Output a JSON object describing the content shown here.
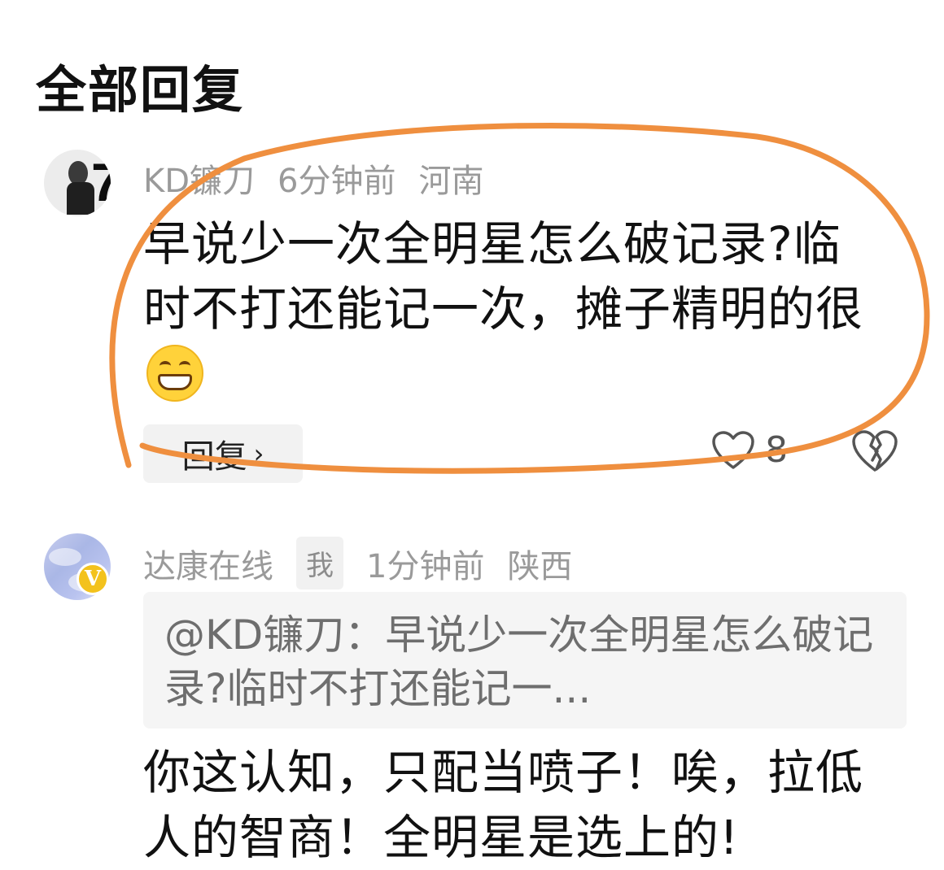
{
  "section": {
    "title": "全部回复"
  },
  "comments": [
    {
      "username": "KD镰刀",
      "time": "6分钟前",
      "location": "河南",
      "text": "早说少一次全明星怎么破记录?临时不打还能记一次，摊子精明的很",
      "emoji": "grinning-face-emoji",
      "reply_label": "回复",
      "like_count": "8",
      "avatar": "player-avatar-with-7"
    },
    {
      "username": "达康在线",
      "me_tag": "我",
      "time": "1分钟前",
      "location": "陕西",
      "quote": "@KD镰刀：早说少一次全明星怎么破记录?临时不打还能记一...",
      "text": "你这认知，只配当喷子！唉，拉低人的智商！全明星是选上的!",
      "badge": "V",
      "avatar": "sky-avatar"
    }
  ],
  "colors": {
    "annotation_circle": "#ef8f3f",
    "meta_text": "#9a9a9a",
    "vip_badge": "#f3c21d"
  },
  "icons": {
    "like": "heart-outline-icon",
    "dislike": "broken-heart-icon",
    "reply_arrow": "chevron-right-icon"
  }
}
